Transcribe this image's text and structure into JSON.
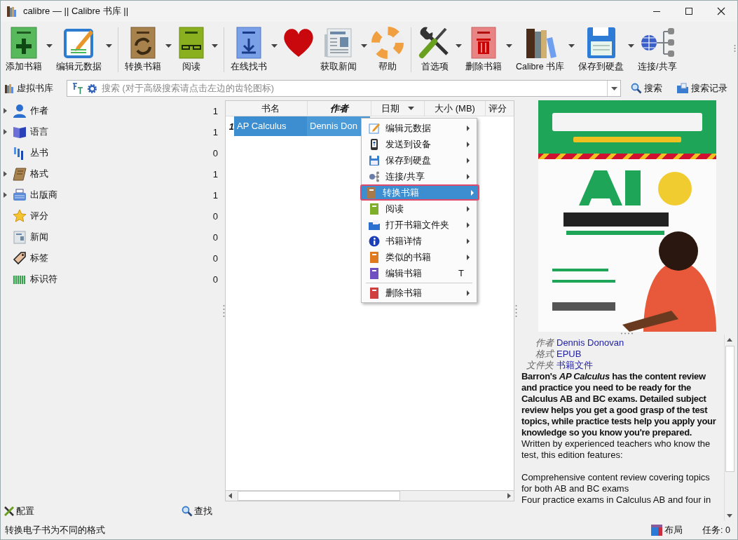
{
  "window": {
    "title": "calibre — || Calibre 书库 ||"
  },
  "toolbar": {
    "groups": [
      [
        {
          "label": "添加书籍",
          "dropdown": true
        },
        {
          "label": "编辑元数据",
          "dropdown": true
        }
      ],
      [
        {
          "label": "转换书籍",
          "dropdown": true
        },
        {
          "label": "阅读",
          "dropdown": true
        }
      ],
      [
        {
          "label": "在线找书",
          "dropdown": true
        },
        {
          "dropdown": false
        },
        {
          "label": "获取新闻",
          "dropdown": true
        },
        {
          "label": "帮助",
          "dropdown": false
        }
      ],
      [
        {
          "label": "首选项",
          "dropdown": true
        },
        {
          "label": "删除书籍",
          "dropdown": true
        },
        {
          "label": "Calibre 书库",
          "dropdown": true
        },
        {
          "label": "保存到硬盘",
          "dropdown": true
        },
        {
          "label": "连接/共享",
          "dropdown": false
        }
      ]
    ]
  },
  "search_bar": {
    "virtual_library": "虚拟书库",
    "placeholder": "搜索 (对于高级搜索请点击左边的齿轮图标)",
    "search_button": "搜索",
    "history_button": "搜索记录"
  },
  "sidebar": {
    "items": [
      {
        "label": "作者",
        "count": "1",
        "expandable": true
      },
      {
        "label": "语言",
        "count": "1",
        "expandable": true
      },
      {
        "label": "丛书",
        "count": "0",
        "expandable": false
      },
      {
        "label": "格式",
        "count": "1",
        "expandable": true
      },
      {
        "label": "出版商",
        "count": "1",
        "expandable": true
      },
      {
        "label": "评分",
        "count": "0",
        "expandable": false
      },
      {
        "label": "新闻",
        "count": "0",
        "expandable": false
      },
      {
        "label": "标签",
        "count": "0",
        "expandable": false
      },
      {
        "label": "标识符",
        "count": "0",
        "expandable": false
      }
    ],
    "configure_button": "配置",
    "find_button": "查找"
  },
  "table": {
    "columns": [
      {
        "label": "书名",
        "sorted": false,
        "dropdown": false
      },
      {
        "label": "作者",
        "sorted": true,
        "dropdown": false
      },
      {
        "label": "日期",
        "sorted": false,
        "dropdown": true
      },
      {
        "label": "大小 (MB)",
        "sorted": false,
        "dropdown": false
      },
      {
        "label": "评分",
        "sorted": false,
        "dropdown": false
      }
    ],
    "rows": [
      {
        "number": "1",
        "cells": [
          "AP Calculus",
          "Dennis Don"
        ],
        "selected": true
      }
    ]
  },
  "context_menu": {
    "groups": [
      [
        {
          "label": "编辑元数据",
          "submenu": true,
          "selected": false
        },
        {
          "label": "发送到设备",
          "submenu": true,
          "selected": false
        },
        {
          "label": "保存到硬盘",
          "submenu": true,
          "selected": false
        },
        {
          "label": "连接/共享",
          "submenu": true,
          "selected": false
        },
        {
          "label": "转换书籍",
          "submenu": true,
          "selected": true
        },
        {
          "label": "阅读",
          "submenu": true,
          "selected": false
        },
        {
          "label": "打开书籍文件夹",
          "submenu": true,
          "selected": false
        },
        {
          "label": "书籍详情",
          "submenu": true,
          "selected": false
        },
        {
          "label": "类似的书籍",
          "submenu": true,
          "selected": false
        },
        {
          "label": "编辑书籍",
          "submenu": false,
          "selected": false,
          "shortcut": "T"
        }
      ],
      [
        {
          "label": "删除书籍",
          "submenu": true,
          "selected": false
        }
      ]
    ]
  },
  "book_details": {
    "fields": [
      {
        "label": "作者",
        "value": "Dennis Donovan"
      },
      {
        "label": "格式",
        "value": "EPUB"
      },
      {
        "label": "文件夹",
        "value": "书籍文件"
      }
    ],
    "paragraphs": [
      {
        "text": "Barron's *AP Calculus* has the content review and practice you need to be ready for the Calculus AB and BC exams. Detailed subject review helps you get a good grasp of the test topics, while practice tests help you apply your knowledge so you know you're prepared.",
        "bold": true
      },
      {
        "text": "Written by experienced teachers who know the test, this edition features:",
        "bold": false
      },
      {
        "text": "Comprehensive content review covering topics for both AB and BC exams",
        "bold": false
      },
      {
        "text": "Four practice exams in Calculus AB and four in",
        "bold": false
      }
    ]
  },
  "status_bar": {
    "message": "转换电子书为不同的格式",
    "layout_button": "布局",
    "jobs": "任务:  0"
  }
}
